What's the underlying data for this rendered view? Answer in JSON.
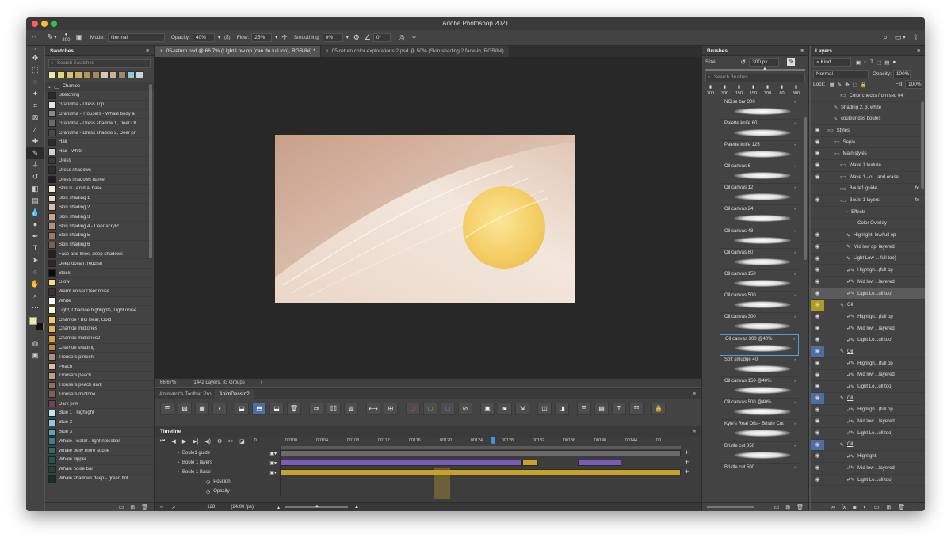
{
  "window": {
    "title": "Adobe Photoshop 2021"
  },
  "options": {
    "brush_size": "300",
    "mode_label": "Mode:",
    "mode": "Normal",
    "opacity_label": "Opacity:",
    "opacity": "40%",
    "flow_label": "Flow:",
    "flow": "25%",
    "smoothing_label": "Smoothing:",
    "smoothing": "0%",
    "angle": "0°"
  },
  "swatches": {
    "title": "Swatches",
    "search_placeholder": "Search Swatches",
    "top_colors": [
      "#f2e6a6",
      "#e8d77a",
      "#d9c36a",
      "#cfae5e",
      "#b9964f",
      "#a7885a",
      "#d6c7b0",
      "#c9b295",
      "#9e8869",
      "#8fc7d3",
      "#cfd6d4"
    ],
    "group": "Chamoe",
    "items": [
      {
        "name": "Sketching",
        "color": "#2b2b2b"
      },
      {
        "name": "Grandma - Dress Top",
        "color": "#e8e3df"
      },
      {
        "name": "Grandma - Trousers - Whale body a",
        "color": "#8a8a8a"
      },
      {
        "name": "Grandma - Dress shadow 1, Deer Ot",
        "color": "#6a6a6a"
      },
      {
        "name": "Grandma - Dress shadow 2, Deer pr",
        "color": "#4a4a4a"
      },
      {
        "name": "Hair",
        "color": "#2a2a2a"
      },
      {
        "name": "Hair - white",
        "color": "#d9d2cc"
      },
      {
        "name": "Dress",
        "color": "#3a3a3a"
      },
      {
        "name": "Dress shadows",
        "color": "#2e2e2e"
      },
      {
        "name": "Dress shadows darker",
        "color": "#1e1e1e"
      },
      {
        "name": "Skin 0 - Animal base",
        "color": "#f5ece4"
      },
      {
        "name": "Skin shading 1",
        "color": "#ead8c8"
      },
      {
        "name": "Skin shading 2",
        "color": "#d8bca5"
      },
      {
        "name": "Skin shading 3",
        "color": "#c9a68e"
      },
      {
        "name": "Skin shading 4 - Deer acrylic",
        "color": "#b38f7a"
      },
      {
        "name": "Skin shading 5",
        "color": "#9b7a6a"
      },
      {
        "name": "Skin shading 6",
        "color": "#7c5f55"
      },
      {
        "name": "Face and lines, deep shadows",
        "color": "#2a1e1c"
      },
      {
        "name": "Deep ocean; reddish",
        "color": "#3a2426"
      },
      {
        "name": "Black",
        "color": "#0a0a0a"
      },
      {
        "name": "Glow",
        "color": "#f3e07a"
      },
      {
        "name": "Warm noise/ Deer noise",
        "color": "#3b3030"
      },
      {
        "name": "White",
        "color": "#ffffff"
      },
      {
        "name": "Light, Chamoe highlights, Light noise",
        "color": "#fff6c9"
      },
      {
        "name": "Chamoe / BG Bear, Gold",
        "color": "#f0cc6a"
      },
      {
        "name": "Chamoe midtones",
        "color": "#e2b556"
      },
      {
        "name": "Chamoe midtones2",
        "color": "#d4a24a"
      },
      {
        "name": "Chamoe shading",
        "color": "#b58a3e"
      },
      {
        "name": "Trousers pinkish",
        "color": "#a88f85"
      },
      {
        "name": "Peach",
        "color": "#e8b89a"
      },
      {
        "name": "Trousers peach",
        "color": "#c99a82"
      },
      {
        "name": "Trousers peach dark",
        "color": "#9a6e60"
      },
      {
        "name": "Trousers midtone",
        "color": "#7e6058"
      },
      {
        "name": "Dark pink",
        "color": "#6e4450"
      },
      {
        "name": "Blue 1 - highlight",
        "color": "#bfe6f2"
      },
      {
        "name": "Blue 2",
        "color": "#8fc9de"
      },
      {
        "name": "Blue 3",
        "color": "#5ea2bd"
      },
      {
        "name": "Whale / water / light noisebar",
        "color": "#3e7f86"
      },
      {
        "name": "Whale belly more subtle",
        "color": "#2f6b65"
      },
      {
        "name": "Whale flipper",
        "color": "#27584f"
      },
      {
        "name": "Whale noise bar",
        "color": "#1f463e"
      },
      {
        "name": "Whale shadows deep - green tint",
        "color": "#15302a"
      }
    ]
  },
  "tabs": [
    {
      "label": "05-return.psd @ 66.7% (Light Low op (can do full too), RGB/8#) *"
    },
    {
      "label": "05-return color explorations 2.psd @ 50% (Skin shading 2 fade-in, RGB/8#)"
    }
  ],
  "status": {
    "zoom": "66.67%",
    "info": "1442 Layers, 83 Groups"
  },
  "animator": {
    "tab1": "Animator's Toolbar Pro",
    "tab2": "AnimDessin2"
  },
  "timeline": {
    "title": "Timeline",
    "frame": "128",
    "fps": "(24.00 fps)",
    "ruler": [
      "0",
      "00100",
      "00104",
      "00108",
      "00112",
      "00116",
      "00120",
      "00124",
      "00128",
      "00132",
      "00136",
      "00140",
      "00144",
      "00"
    ],
    "tracks": [
      {
        "label": "Boule1 guide",
        "prop": false
      },
      {
        "label": "Boule 1 layers",
        "prop": false
      },
      {
        "label": "Boule 1 Base",
        "prop": false
      },
      {
        "label": "Position",
        "prop": true
      },
      {
        "label": "Opacity",
        "prop": true
      }
    ]
  },
  "brushes": {
    "title": "Brushes",
    "size_label": "Size:",
    "size": "300 px",
    "search_placeholder": "Search Brushes",
    "recent": [
      "300",
      "300",
      "150",
      "150",
      "300",
      "80",
      "300"
    ],
    "items": [
      {
        "name": "NOise bar 300"
      },
      {
        "name": "Palette knife 60"
      },
      {
        "name": "Palette knife 125"
      },
      {
        "name": "Oil canvas 6"
      },
      {
        "name": "Oil canvas 12"
      },
      {
        "name": "Oil canvas 24"
      },
      {
        "name": "Oil canvas 48"
      },
      {
        "name": "Oil canvas 80"
      },
      {
        "name": "Oil canvas 150"
      },
      {
        "name": "Oil canvas 500"
      },
      {
        "name": "Oil canvas 300"
      },
      {
        "name": "Oil canvas 300 @40%"
      },
      {
        "name": "Soft smudge 40"
      },
      {
        "name": "Oil canvas 150 @40%"
      },
      {
        "name": "Oil canvas 500 @40%"
      },
      {
        "name": "Kyle's Real Oils - Bristle Cut"
      },
      {
        "name": "Bristle cut 350"
      },
      {
        "name": "Bristle cut 500"
      }
    ]
  },
  "layers": {
    "title": "Layers",
    "kind": "Kind",
    "blend": "Normal",
    "opacity_label": "Opacity:",
    "opacity": "100%",
    "lock_label": "Lock:",
    "fill_label": "Fill:",
    "fill": "100%",
    "items": [
      {
        "name": "Color checks from seq 04",
        "indent": 2,
        "type": "group",
        "eye": false
      },
      {
        "name": "Shading 2, 3, white",
        "indent": 1,
        "type": "brush",
        "eye": false
      },
      {
        "name": "couleur des boules",
        "indent": 1,
        "type": "brush",
        "eye": false
      },
      {
        "name": "Styles",
        "indent": 0,
        "type": "group",
        "eye": true
      },
      {
        "name": "Sepia",
        "indent": 1,
        "type": "group",
        "eye": true
      },
      {
        "name": "Main styles",
        "indent": 1,
        "type": "group",
        "eye": true
      },
      {
        "name": "Wave 1 texture",
        "indent": 2,
        "type": "group",
        "eye": true
      },
      {
        "name": "Wave 1 - o... and erase",
        "indent": 2,
        "type": "group",
        "eye": true
      },
      {
        "name": "Boule1 guide",
        "indent": 2,
        "type": "group",
        "eye": false,
        "fx": true
      },
      {
        "name": "Boule 1 layers",
        "indent": 2,
        "type": "group",
        "eye": true,
        "fx": true
      },
      {
        "name": "Effects",
        "indent": 3,
        "type": "plain",
        "eye": false
      },
      {
        "name": "Color Overlay",
        "indent": 4,
        "type": "plain",
        "eye": false
      },
      {
        "name": "Highlight, low/full op",
        "indent": 3,
        "type": "brush",
        "eye": true
      },
      {
        "name": "Mid low op, layered",
        "indent": 3,
        "type": "brush",
        "eye": true
      },
      {
        "name": "Light Low ... full too)",
        "indent": 3,
        "type": "brush",
        "eye": true
      },
      {
        "name": "Highligh...(full op",
        "indent": 3,
        "type": "clip",
        "eye": true
      },
      {
        "name": "Mid low ...layered",
        "indent": 3,
        "type": "clip",
        "eye": true
      },
      {
        "name": "Light Lo...ull too)",
        "indent": 3,
        "type": "clip",
        "eye": true,
        "sel": true
      },
      {
        "name": "Oil",
        "indent": 2,
        "type": "brush",
        "eye": true,
        "color": "#b39a1d",
        "ul": true
      },
      {
        "name": "Highligh...(full op",
        "indent": 3,
        "type": "clip",
        "eye": true
      },
      {
        "name": "Mid low ...layered",
        "indent": 3,
        "type": "clip",
        "eye": true
      },
      {
        "name": "Light Lo...ull too)",
        "indent": 3,
        "type": "clip",
        "eye": true
      },
      {
        "name": "Oil",
        "indent": 2,
        "type": "brush",
        "eye": true,
        "color": "#4a6fa5",
        "ul": true
      },
      {
        "name": "Highligh...(full op",
        "indent": 3,
        "type": "clip",
        "eye": true
      },
      {
        "name": "Mid low ...layered",
        "indent": 3,
        "type": "clip",
        "eye": true
      },
      {
        "name": "Light Lo...ull too)",
        "indent": 3,
        "type": "clip",
        "eye": true
      },
      {
        "name": "Oil",
        "indent": 2,
        "type": "brush",
        "eye": true,
        "color": "#4a6fa5",
        "ul": true
      },
      {
        "name": "Highligh...(full op",
        "indent": 3,
        "type": "clip",
        "eye": true
      },
      {
        "name": "Mid low ...layered",
        "indent": 3,
        "type": "clip",
        "eye": true
      },
      {
        "name": "Light Lo...ull too)",
        "indent": 3,
        "type": "clip",
        "eye": true
      },
      {
        "name": "Oil",
        "indent": 2,
        "type": "brush",
        "eye": true,
        "color": "#4a6fa5",
        "ul": true
      },
      {
        "name": "Highlight",
        "indent": 3,
        "type": "clip",
        "eye": true
      },
      {
        "name": "Mid low ...layered",
        "indent": 3,
        "type": "clip",
        "eye": true
      },
      {
        "name": "Light Lo...ull too)",
        "indent": 3,
        "type": "clip",
        "eye": true
      }
    ]
  },
  "colors": {
    "foreground": "#f3e7a3",
    "background": "#111111"
  }
}
